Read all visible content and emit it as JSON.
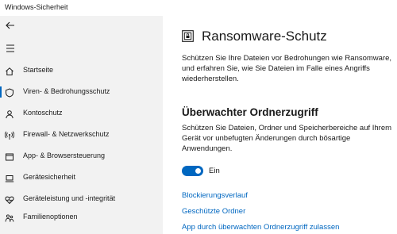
{
  "window": {
    "title": "Windows-Sicherheit"
  },
  "colors": {
    "accent": "#0067c0",
    "link": "#0067c0",
    "sidebar_bg": "#f2f2f2"
  },
  "sidebar": {
    "back_icon": "back-arrow-icon",
    "menu_icon": "hamburger-menu-icon",
    "items": [
      {
        "label": "Startseite",
        "icon": "home-icon",
        "selected": false
      },
      {
        "label": "Viren- & Bedrohungsschutz",
        "icon": "shield-icon",
        "selected": true
      },
      {
        "label": "Kontoschutz",
        "icon": "person-icon",
        "selected": false
      },
      {
        "label": "Firewall- & Netzwerkschutz",
        "icon": "wifi-antenna-icon",
        "selected": false
      },
      {
        "label": "App- & Browsersteuerung",
        "icon": "app-window-icon",
        "selected": false
      },
      {
        "label": "Gerätesicherheit",
        "icon": "laptop-icon",
        "selected": false
      },
      {
        "label": "Geräteleistung und -integrität",
        "icon": "heart-icon",
        "selected": false
      },
      {
        "label": "Familienoptionen",
        "icon": "family-icon",
        "selected": false
      }
    ]
  },
  "main": {
    "icon": "ransomware-icon",
    "title": "Ransomware-Schutz",
    "intro": "Schützen Sie Ihre Dateien vor Bedrohungen wie Ransomware, und erfahren Sie, wie Sie Dateien im Falle eines Angriffs wiederherstellen.",
    "section": {
      "title": "Überwachter Ordnerzugriff",
      "description": "Schützen Sie Dateien, Ordner und Speicherbereiche auf Ihrem Gerät vor unbefugten Änderungen durch bösartige Anwendungen.",
      "toggle": {
        "state": "on",
        "label": "Ein"
      }
    },
    "links": [
      "Blockierungsverlauf",
      "Geschützte Ordner",
      "App durch überwachten Ordnerzugriff zulassen"
    ]
  }
}
